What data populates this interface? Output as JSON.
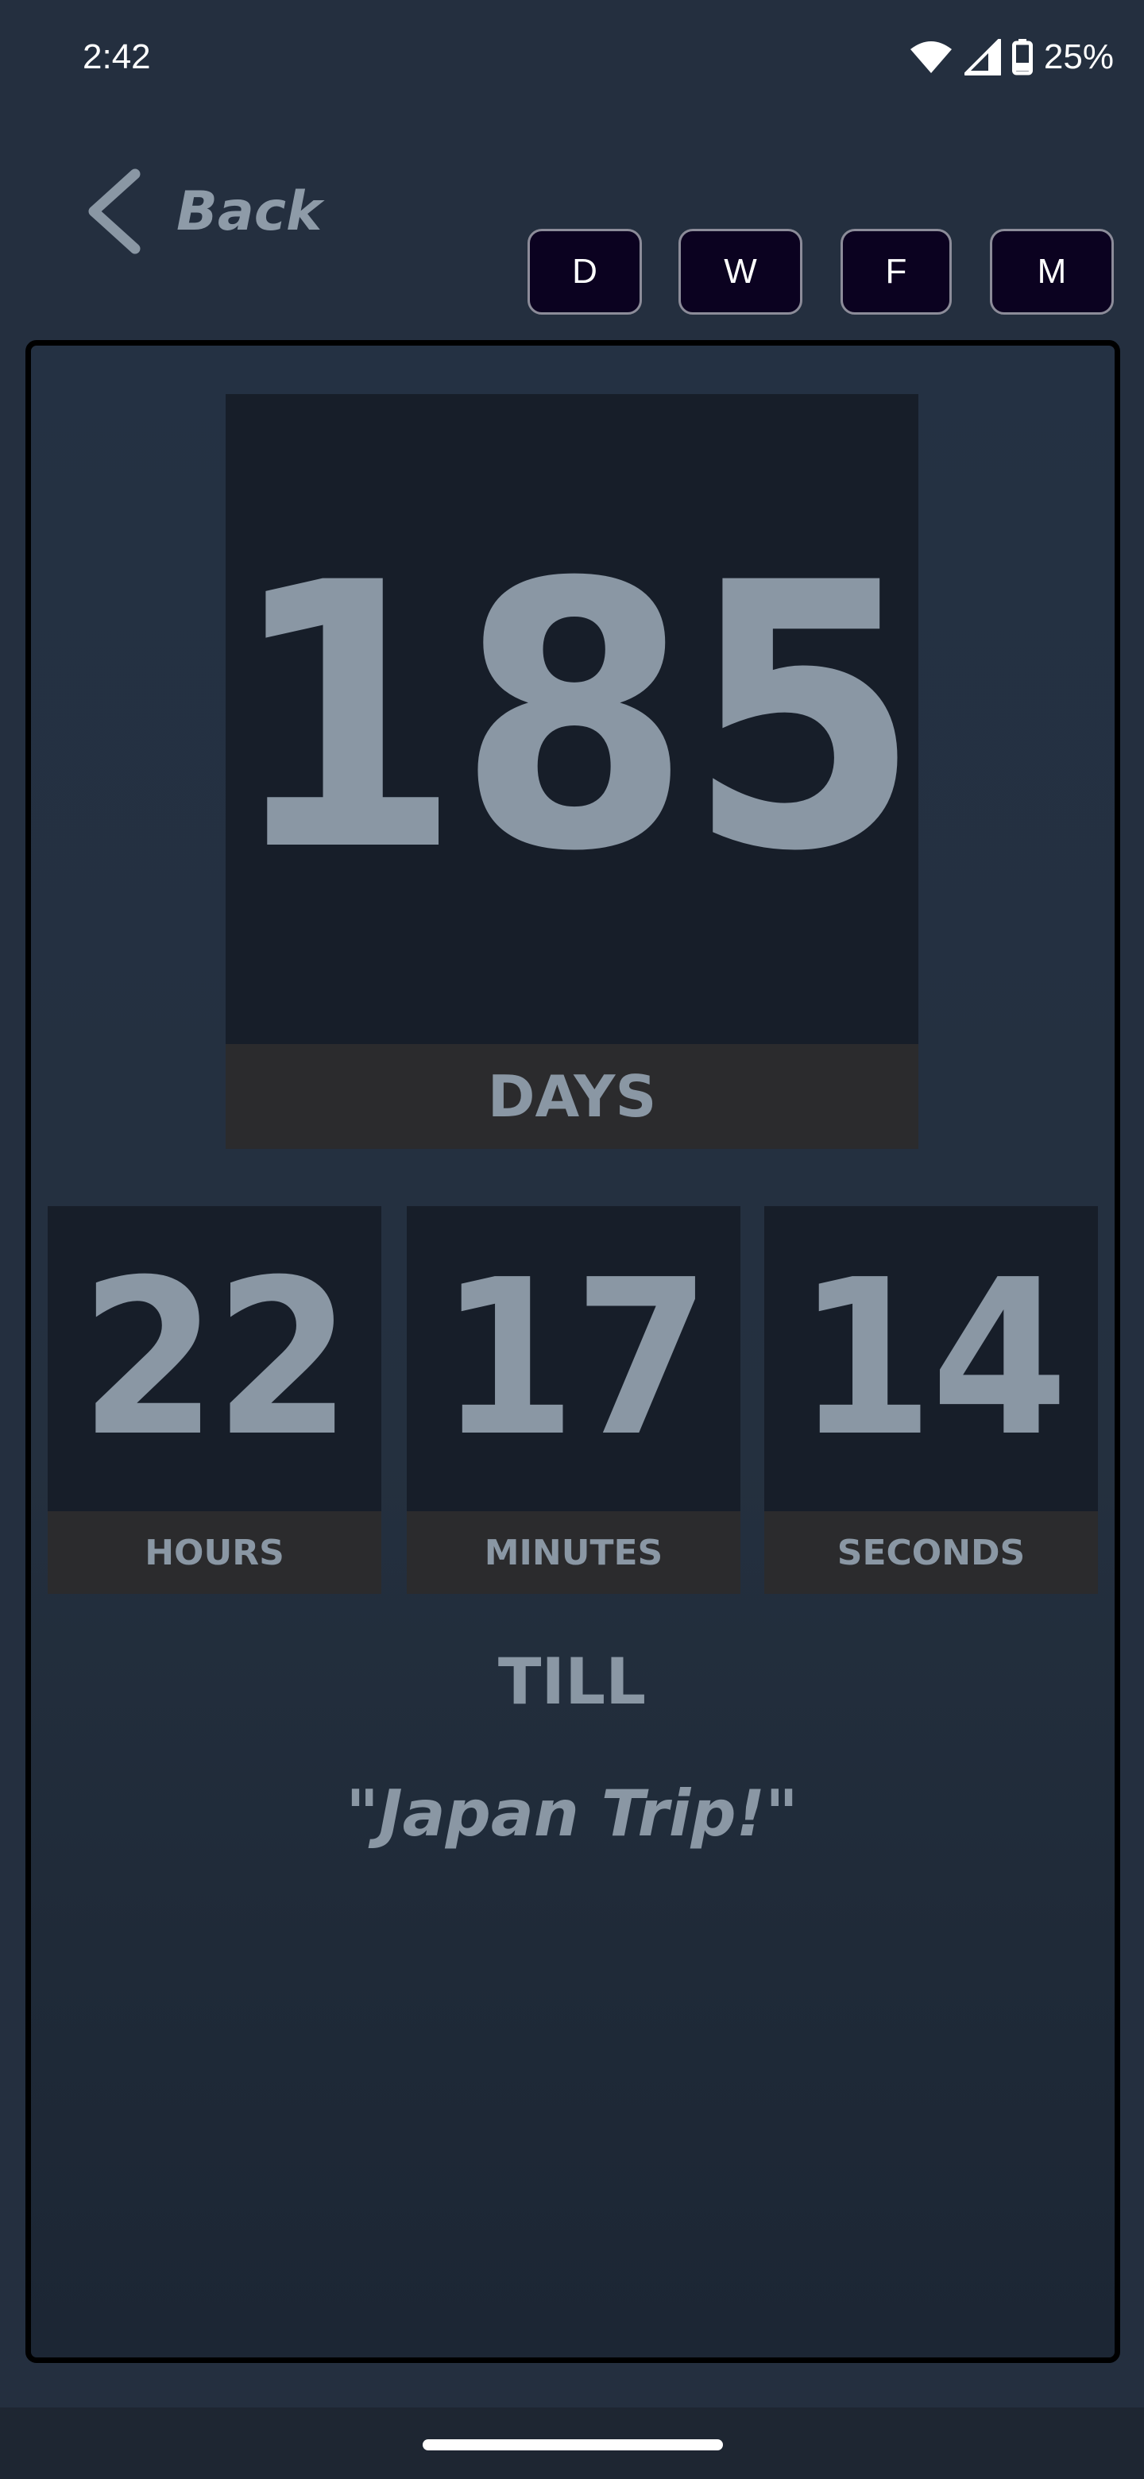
{
  "status_bar": {
    "time": "2:42",
    "battery_percent": "25%",
    "icons": [
      "wifi-icon",
      "cellular-signal-icon",
      "battery-icon"
    ]
  },
  "header": {
    "back_label": "Back",
    "modes": [
      "D",
      "W",
      "F",
      "M"
    ]
  },
  "countdown": {
    "days": {
      "value": "185",
      "label": "DAYS"
    },
    "hours": {
      "value": "22",
      "label": "HOURS"
    },
    "minutes": {
      "value": "17",
      "label": "MINUTES"
    },
    "seconds": {
      "value": "14",
      "label": "SECONDS"
    }
  },
  "till_label": "TILL",
  "event_name": "\"Japan Trip!\"",
  "colors": {
    "background": "#242f3f",
    "number_box": "#171e29",
    "label_bar": "#2b2b2d",
    "text_muted": "#8a97a4",
    "mode_button_bg": "#0b0220"
  }
}
